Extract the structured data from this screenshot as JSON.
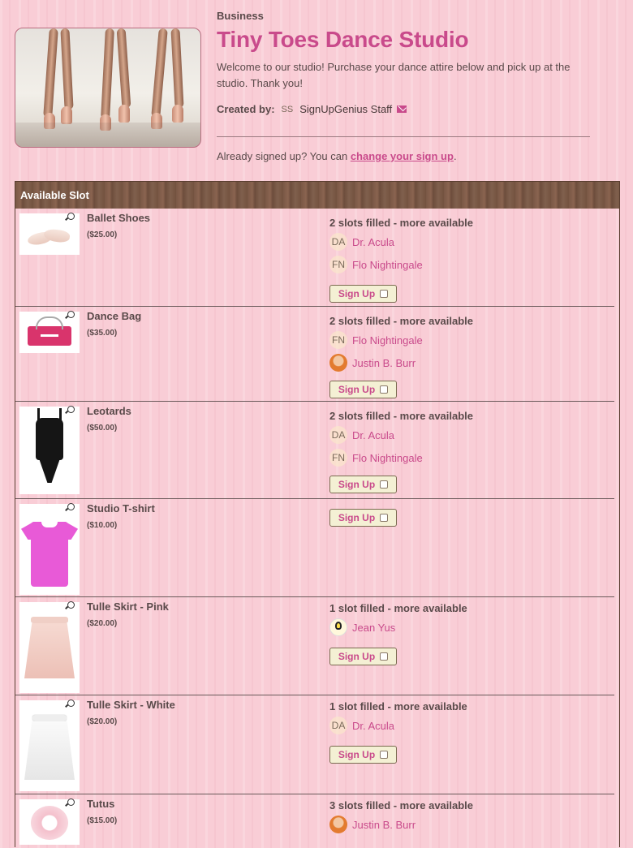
{
  "page": {
    "category": "Business",
    "title": "Tiny Toes Dance Studio",
    "description": "Welcome to our studio! Purchase your dance attire below and pick up at the studio. Thank you!",
    "created_by_label": "Created by:",
    "creator_initials": "SS",
    "creator_name": "SignUpGenius Staff",
    "already_text": "Already signed up? You can",
    "change_link": "change your sign up",
    "already_end": "."
  },
  "table": {
    "header": "Available Slot",
    "signup_label": "Sign Up",
    "rows": [
      {
        "name": "Ballet Shoes",
        "price": "($25.00)",
        "status": "2 slots filled - more available",
        "people": [
          {
            "initials": "DA",
            "name": "Dr. Acula"
          },
          {
            "initials": "FN",
            "name": "Flo Nightingale"
          }
        ]
      },
      {
        "name": "Dance Bag",
        "price": "($35.00)",
        "status": "2 slots filled - more available",
        "people": [
          {
            "initials": "FN",
            "name": "Flo Nightingale"
          },
          {
            "initials": "",
            "name": "Justin B. Burr",
            "avatar": "justin-avatar"
          }
        ]
      },
      {
        "name": "Leotards",
        "price": "($50.00)",
        "status": "2 slots filled - more available",
        "people": [
          {
            "initials": "DA",
            "name": "Dr. Acula"
          },
          {
            "initials": "FN",
            "name": "Flo Nightingale"
          }
        ]
      },
      {
        "name": "Studio T-shirt",
        "price": "($10.00)",
        "status": "",
        "people": []
      },
      {
        "name": "Tulle Skirt - Pink",
        "price": "($20.00)",
        "status": "1 slot filled - more available",
        "people": [
          {
            "initials": "",
            "name": "Jean Yus",
            "avatar": "lightbulb-avatar"
          }
        ]
      },
      {
        "name": "Tulle Skirt - White",
        "price": "($20.00)",
        "status": "1 slot filled - more available",
        "people": [
          {
            "initials": "DA",
            "name": "Dr. Acula"
          }
        ]
      },
      {
        "name": "Tutus",
        "price": "($15.00)",
        "status": "3 slots filled - more available",
        "people": [
          {
            "initials": "",
            "name": "Justin B. Burr",
            "avatar": "justin-avatar"
          }
        ]
      }
    ]
  },
  "colors": {
    "accent": "#c94a8b",
    "background": "#f9cdd6",
    "header_wood": "#7a5846",
    "button_bg": "#f4f0d4"
  }
}
